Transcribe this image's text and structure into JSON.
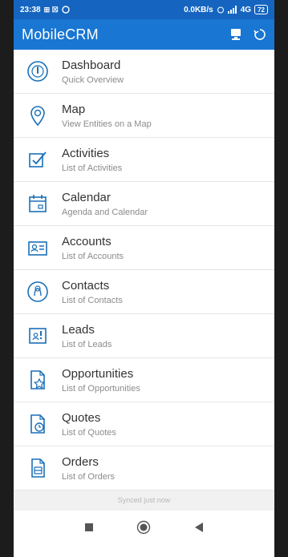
{
  "status": {
    "time": "23:38",
    "left_icons": "⊞ ☒",
    "net_speed": "0.0KB/s",
    "network": "4G",
    "battery": "72"
  },
  "app": {
    "title": "MobileCRM"
  },
  "menu": [
    {
      "label": "Dashboard",
      "sub": "Quick Overview"
    },
    {
      "label": "Map",
      "sub": "View Entities on a Map"
    },
    {
      "label": "Activities",
      "sub": "List of Activities"
    },
    {
      "label": "Calendar",
      "sub": "Agenda and Calendar"
    },
    {
      "label": "Accounts",
      "sub": "List of Accounts"
    },
    {
      "label": "Contacts",
      "sub": "List of Contacts"
    },
    {
      "label": "Leads",
      "sub": "List of Leads"
    },
    {
      "label": "Opportunities",
      "sub": "List of Opportunities"
    },
    {
      "label": "Quotes",
      "sub": "List of Quotes"
    },
    {
      "label": "Orders",
      "sub": "List of Orders"
    }
  ],
  "sync_status": "Synced just now",
  "colors": {
    "statusbar": "#1565c0",
    "appbar": "#1976d2",
    "icon": "#1a6fb8"
  },
  "icons": [
    "dashboard-icon",
    "map-pin-icon",
    "activities-icon",
    "calendar-icon",
    "accounts-icon",
    "contacts-icon",
    "leads-icon",
    "opportunities-icon",
    "quotes-icon",
    "orders-icon"
  ]
}
